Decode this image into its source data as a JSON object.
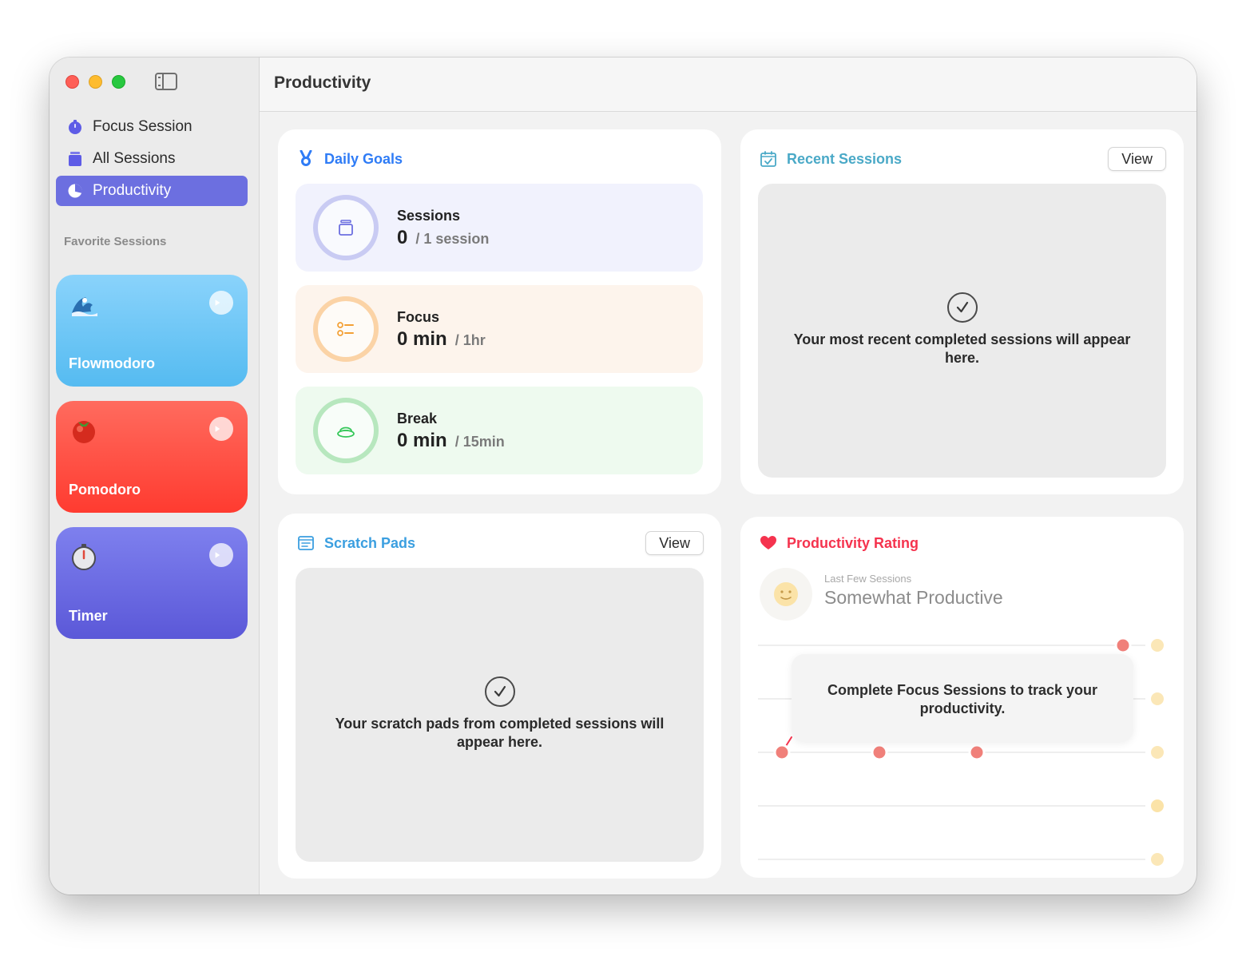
{
  "window": {
    "title": "Productivity"
  },
  "sidebar": {
    "items": [
      {
        "label": "Focus Session",
        "icon": "stopwatch-icon",
        "active": false
      },
      {
        "label": "All Sessions",
        "icon": "stack-icon",
        "active": false
      },
      {
        "label": "Productivity",
        "icon": "pie-chart-icon",
        "active": true
      }
    ],
    "favorites_label": "Favorite Sessions",
    "favorites": [
      {
        "name": "Flowmodoro",
        "icon": "wave-icon",
        "color": "#5ABDF2"
      },
      {
        "name": "Pomodoro",
        "icon": "tomato-icon",
        "color": "#FF3B30"
      },
      {
        "name": "Timer",
        "icon": "stopwatch-icon",
        "color": "#5E5CE6"
      }
    ]
  },
  "daily_goals": {
    "title": "Daily Goals",
    "goals": [
      {
        "title": "Sessions",
        "value": "0",
        "target": "/ 1 session",
        "color": "#C9CBF3"
      },
      {
        "title": "Focus",
        "value": "0 min",
        "target": "/ 1hr",
        "color": "#FBD3A6"
      },
      {
        "title": "Break",
        "value": "0 min",
        "target": "/ 15min",
        "color": "#B7E7BE"
      }
    ]
  },
  "recent_sessions": {
    "title": "Recent Sessions",
    "view_label": "View",
    "empty_text": "Your most recent completed sessions will appear here."
  },
  "scratch_pads": {
    "title": "Scratch Pads",
    "view_label": "View",
    "empty_text": "Your scratch pads from completed sessions will appear here."
  },
  "productivity_rating": {
    "title": "Productivity Rating",
    "subtitle": "Last Few Sessions",
    "rating": "Somewhat Productive",
    "overlay_text": "Complete Focus Sessions to track your productivity.",
    "colors": {
      "accent": "#F5334E",
      "point": "#F0807A"
    }
  },
  "colors": {
    "accent": "#6C6FE0",
    "daily_goals_title": "#2F7CF6",
    "recent_title": "#4AA9C7",
    "scratch_title": "#3B9FE0"
  }
}
